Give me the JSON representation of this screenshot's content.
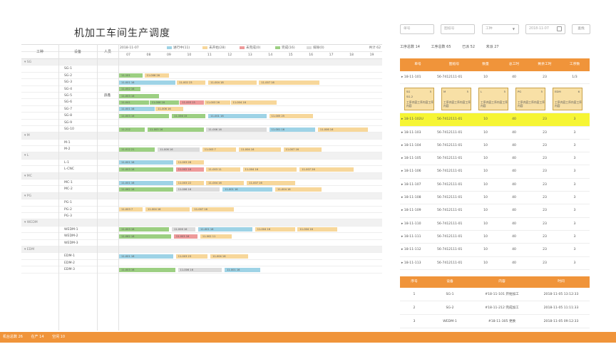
{
  "title": "机加工车间生产调度",
  "gantt": {
    "headers": {
      "process": "工种",
      "equipment": "设备",
      "person": "人员"
    },
    "date": "2018-11-07",
    "legend": [
      {
        "label": "进行中(11)",
        "color": "#9ed3e6"
      },
      {
        "label": "未开始(28)",
        "color": "#f7d79a"
      },
      {
        "label": "未完成(0)",
        "color": "#ee9a9a"
      },
      {
        "label": "完成(16)",
        "color": "#9ccf82"
      },
      {
        "label": "排除(0)",
        "color": "#dcdcdc"
      }
    ],
    "total": "共计 62",
    "hours": [
      "07",
      "08",
      "09",
      "10",
      "11",
      "12",
      "13",
      "14",
      "15",
      "16",
      "17",
      "18",
      "19"
    ],
    "rows": [
      {
        "type": "group",
        "label": "SG"
      },
      {
        "type": "eq",
        "label": "SG-1"
      },
      {
        "type": "eq",
        "label": "SG-2",
        "bars": [
          {
            "s": 0.0,
            "e": 1.2,
            "c": "g",
            "t": "11-101"
          },
          {
            "s": 1.25,
            "e": 2.5,
            "c": "y",
            "t": "11-006 26"
          }
        ]
      },
      {
        "type": "eq",
        "label": "SG-3",
        "bars": [
          {
            "s": 0.0,
            "e": 2.8,
            "c": "b",
            "t": "11-001 16"
          },
          {
            "s": 2.85,
            "e": 4.3,
            "c": "y",
            "t": "11-002 23"
          },
          {
            "s": 4.4,
            "e": 6.8,
            "c": "y",
            "t": "11-004 18"
          },
          {
            "s": 6.9,
            "e": 9.9,
            "c": "y",
            "t": "11-007 16"
          }
        ]
      },
      {
        "type": "eq",
        "label": "SG-4",
        "bars": [
          {
            "s": 0.0,
            "e": 1.1,
            "c": "g",
            "t": "11-052 16"
          }
        ]
      },
      {
        "type": "eq",
        "label": "SG-5",
        "person": "薛鑫",
        "bars": [
          {
            "s": 0.0,
            "e": 2.0,
            "c": "g",
            "t": "11-003 16"
          }
        ]
      },
      {
        "type": "eq",
        "label": "SG-6",
        "bars": [
          {
            "s": 0.0,
            "e": 1.5,
            "c": "g",
            "t": "11-041"
          },
          {
            "s": 1.5,
            "e": 3.0,
            "c": "g",
            "t": "11-006 16"
          },
          {
            "s": 3.0,
            "e": 4.2,
            "c": "r",
            "t": "11-003 15"
          },
          {
            "s": 4.2,
            "e": 5.5,
            "c": "y",
            "t": "11-003 26"
          },
          {
            "s": 5.5,
            "e": 7.8,
            "c": "y",
            "t": "11-004 16"
          }
        ]
      },
      {
        "type": "eq",
        "label": "SG-7",
        "bars": [
          {
            "s": 0.0,
            "e": 1.8,
            "c": "b",
            "t": "11-001 16"
          },
          {
            "s": 1.8,
            "e": 3.2,
            "c": "y",
            "t": "11-006 16"
          }
        ]
      },
      {
        "type": "eq",
        "label": "SG-8",
        "bars": [
          {
            "s": 0.0,
            "e": 2.5,
            "c": "g",
            "t": "11-003 16"
          },
          {
            "s": 2.6,
            "e": 4.3,
            "c": "g",
            "t": "11-336 15"
          },
          {
            "s": 4.4,
            "e": 7.3,
            "c": "b",
            "t": "11-001 16"
          },
          {
            "s": 7.4,
            "e": 9.6,
            "c": "y",
            "t": "11-005 25"
          }
        ]
      },
      {
        "type": "eq",
        "label": "SG-9"
      },
      {
        "type": "eq",
        "label": "SG-10",
        "bars": [
          {
            "s": 0.0,
            "e": 1.3,
            "c": "g",
            "t": "11-212"
          },
          {
            "s": 1.4,
            "e": 4.2,
            "c": "g",
            "t": "11-003 16"
          },
          {
            "s": 4.3,
            "e": 7.3,
            "c": "x",
            "t": "11-006 16"
          },
          {
            "s": 7.4,
            "e": 9.7,
            "c": "b",
            "t": "11-001 16"
          },
          {
            "s": 9.8,
            "e": 12.3,
            "c": "y",
            "t": "11-006 16"
          }
        ]
      },
      {
        "type": "group",
        "label": "M"
      },
      {
        "type": "eq",
        "label": "M-1"
      },
      {
        "type": "eq",
        "label": "M-2",
        "bars": [
          {
            "s": 0.0,
            "e": 1.8,
            "c": "g",
            "t": "11-012 21"
          },
          {
            "s": 1.9,
            "e": 4.0,
            "c": "x",
            "t": "11-006 16"
          },
          {
            "s": 4.1,
            "e": 5.8,
            "c": "y",
            "t": "11-003 7"
          },
          {
            "s": 5.9,
            "e": 8.0,
            "c": "y",
            "t": "11-004 16"
          },
          {
            "s": 8.1,
            "e": 10.0,
            "c": "y",
            "t": "11-007 16"
          }
        ]
      },
      {
        "type": "group",
        "label": "L"
      },
      {
        "type": "eq",
        "label": "L-1",
        "bars": [
          {
            "s": 0.0,
            "e": 2.7,
            "c": "b",
            "t": "11-001 16"
          },
          {
            "s": 2.8,
            "e": 4.2,
            "c": "y",
            "t": "11-003 28"
          }
        ]
      },
      {
        "type": "eq",
        "label": "L-CNC",
        "bars": [
          {
            "s": 0.0,
            "e": 2.7,
            "c": "g",
            "t": "11-003 16"
          },
          {
            "s": 2.8,
            "e": 4.2,
            "c": "r",
            "t": "11-002 16"
          },
          {
            "s": 4.3,
            "e": 6.0,
            "c": "y",
            "t": "11-003 11"
          },
          {
            "s": 6.1,
            "e": 8.8,
            "c": "y",
            "t": "11-004 16"
          },
          {
            "s": 8.9,
            "e": 11.6,
            "c": "y",
            "t": "11-007 26"
          }
        ]
      },
      {
        "type": "group",
        "label": "MC"
      },
      {
        "type": "eq",
        "label": "MC-1",
        "bars": [
          {
            "s": 0.0,
            "e": 2.7,
            "c": "b",
            "t": "11-001 16"
          },
          {
            "s": 2.8,
            "e": 4.2,
            "c": "y",
            "t": "11-003 22"
          },
          {
            "s": 4.3,
            "e": 6.2,
            "c": "y",
            "t": "11-004 16"
          },
          {
            "s": 6.3,
            "e": 8.7,
            "c": "y",
            "t": "11-007 16"
          }
        ]
      },
      {
        "type": "eq",
        "label": "MC-2",
        "bars": [
          {
            "s": 0.0,
            "e": 2.7,
            "c": "g",
            "t": "11-062 16"
          },
          {
            "s": 2.8,
            "e": 5.0,
            "c": "x",
            "t": "11-006 16"
          },
          {
            "s": 5.1,
            "e": 7.6,
            "c": "b",
            "t": "11-001 16"
          },
          {
            "s": 7.7,
            "e": 10.0,
            "c": "y",
            "t": "11-004 16"
          }
        ]
      },
      {
        "type": "group",
        "label": "PG"
      },
      {
        "type": "eq",
        "label": "PG-1"
      },
      {
        "type": "eq",
        "label": "PG-2",
        "bars": [
          {
            "s": 0.0,
            "e": 1.2,
            "c": "y",
            "t": "11-003 7"
          },
          {
            "s": 1.3,
            "e": 3.5,
            "c": "y",
            "t": "11-004 16"
          },
          {
            "s": 3.6,
            "e": 5.7,
            "c": "y",
            "t": "11-007 16"
          }
        ]
      },
      {
        "type": "eq",
        "label": "PG-3"
      },
      {
        "type": "group",
        "label": "WEDM"
      },
      {
        "type": "eq",
        "label": "WEDM-1",
        "bars": [
          {
            "s": 0.0,
            "e": 2.5,
            "c": "g",
            "t": "11-003 16"
          },
          {
            "s": 2.6,
            "e": 3.8,
            "c": "x",
            "t": "11-006 16"
          },
          {
            "s": 3.9,
            "e": 6.6,
            "c": "b",
            "t": "11-001 16"
          },
          {
            "s": 6.7,
            "e": 8.7,
            "c": "y",
            "t": "11-004 16"
          },
          {
            "s": 8.8,
            "e": 10.8,
            "c": "y",
            "t": "11-004 16"
          }
        ]
      },
      {
        "type": "eq",
        "label": "WEDM-2",
        "bars": [
          {
            "s": 0.0,
            "e": 2.6,
            "c": "g",
            "t": "11-062 16"
          },
          {
            "s": 2.7,
            "e": 3.9,
            "c": "r",
            "t": "11-003 16"
          },
          {
            "s": 4.0,
            "e": 5.6,
            "c": "y",
            "t": "11-002 11"
          }
        ]
      },
      {
        "type": "eq",
        "label": "WEDM-3"
      },
      {
        "type": "group",
        "label": "EDM"
      },
      {
        "type": "eq",
        "label": "EDM-1",
        "bars": [
          {
            "s": 0.0,
            "e": 2.7,
            "c": "b",
            "t": "11-001 16"
          },
          {
            "s": 2.8,
            "e": 4.4,
            "c": "y",
            "t": "11-003 23"
          },
          {
            "s": 4.5,
            "e": 6.4,
            "c": "y",
            "t": "11-004 16"
          }
        ]
      },
      {
        "type": "eq",
        "label": "EDM-2"
      },
      {
        "type": "eq",
        "label": "EDM-3",
        "bars": [
          {
            "s": 0.0,
            "e": 2.8,
            "c": "g",
            "t": "11-003 16"
          },
          {
            "s": 2.9,
            "e": 5.1,
            "c": "x",
            "t": "11-006 16"
          },
          {
            "s": 5.2,
            "e": 7.0,
            "c": "b",
            "t": "11-001 16"
          }
        ]
      }
    ]
  },
  "filters": {
    "order": "单号",
    "drawing": "图纸号",
    "process": "工种",
    "date": "2018-11-07",
    "search": "查找"
  },
  "stats": {
    "total": "工序总数  14",
    "done": "工序总数  65",
    "finished": "已派  52",
    "pending": "未派  27"
  },
  "rtable": {
    "headers": [
      "单号",
      "图纸号",
      "数量",
      "总工时",
      "剩余工时",
      "工序数"
    ],
    "rows": [
      {
        "order": "18-11-101",
        "drawing": "56-7412111-01",
        "qty": "10",
        "total": "40",
        "remain": "23",
        "steps": "1/3"
      },
      {
        "order": "18-11-102U",
        "drawing": "56-7412111-01",
        "qty": "10",
        "total": "40",
        "remain": "23",
        "steps": "3"
      },
      {
        "order": "18-11-103",
        "drawing": "56-7412111-01",
        "qty": "10",
        "total": "40",
        "remain": "23",
        "steps": "3"
      },
      {
        "order": "18-11-104",
        "drawing": "56-7412111-01",
        "qty": "10",
        "total": "40",
        "remain": "23",
        "steps": "3"
      },
      {
        "order": "18-11-105",
        "drawing": "56-7412111-01",
        "qty": "10",
        "total": "40",
        "remain": "23",
        "steps": "3"
      },
      {
        "order": "18-11-106",
        "drawing": "56-7412111-01",
        "qty": "10",
        "total": "40",
        "remain": "23",
        "steps": "3"
      },
      {
        "order": "18-11-107",
        "drawing": "56-7412111-01",
        "qty": "10",
        "total": "40",
        "remain": "23",
        "steps": "3"
      },
      {
        "order": "18-11-108",
        "drawing": "56-7412111-01",
        "qty": "10",
        "total": "40",
        "remain": "23",
        "steps": "3"
      },
      {
        "order": "18-11-109",
        "drawing": "56-7412111-01",
        "qty": "10",
        "total": "40",
        "remain": "23",
        "steps": "3"
      },
      {
        "order": "18-11-110",
        "drawing": "56-7412111-01",
        "qty": "10",
        "total": "40",
        "remain": "23",
        "steps": "3"
      },
      {
        "order": "18-11-111",
        "drawing": "56-7412111-01",
        "qty": "10",
        "total": "40",
        "remain": "23",
        "steps": "3"
      },
      {
        "order": "18-11-112",
        "drawing": "56-7412111-01",
        "qty": "10",
        "total": "40",
        "remain": "23",
        "steps": "3"
      },
      {
        "order": "18-11-113",
        "drawing": "56-7412111-01",
        "qty": "10",
        "total": "40",
        "remain": "23",
        "steps": "3"
      }
    ],
    "cards": [
      {
        "name": "SG",
        "num": "5",
        "sub": "SG-2",
        "text": "工序内容工序内容工序内容"
      },
      {
        "name": "M",
        "num": "5",
        "sub": "",
        "text": "工序内容工序内容工序内容"
      },
      {
        "name": "L",
        "num": "5",
        "sub": "",
        "text": "工序内容工序内容工序内容"
      },
      {
        "name": "PG",
        "num": "5",
        "sub": "",
        "text": "工序内容工序内容工序内容"
      },
      {
        "name": "EDM",
        "num": "6",
        "sub": "",
        "text": "工序内容工序内容工序内容"
      }
    ]
  },
  "btable": {
    "headers": [
      "序号",
      "设备",
      "内容",
      "时间"
    ],
    "rows": [
      {
        "no": "1",
        "eq": "SG-1",
        "content": "#18-11-101 开始加工",
        "time": "2018-11-05 13:12:33"
      },
      {
        "no": "2",
        "eq": "SG-2",
        "content": "#18-11-212 完成加工",
        "time": "2018-11-05 11:11:33"
      },
      {
        "no": "3",
        "eq": "WEDM-1",
        "content": "#18-11-305 更换",
        "time": "2018-11-05 09:12:33"
      }
    ]
  },
  "footer": {
    "machines": "机台总数  26",
    "producing": "在产  14",
    "idle": "空闲  10"
  },
  "colors": {
    "b": "#9ed3e6",
    "y": "#f7d79a",
    "r": "#ee9a9a",
    "g": "#9ccf82",
    "x": "#dcdcdc",
    "accent": "#f0943a",
    "select": "#f6f534"
  }
}
